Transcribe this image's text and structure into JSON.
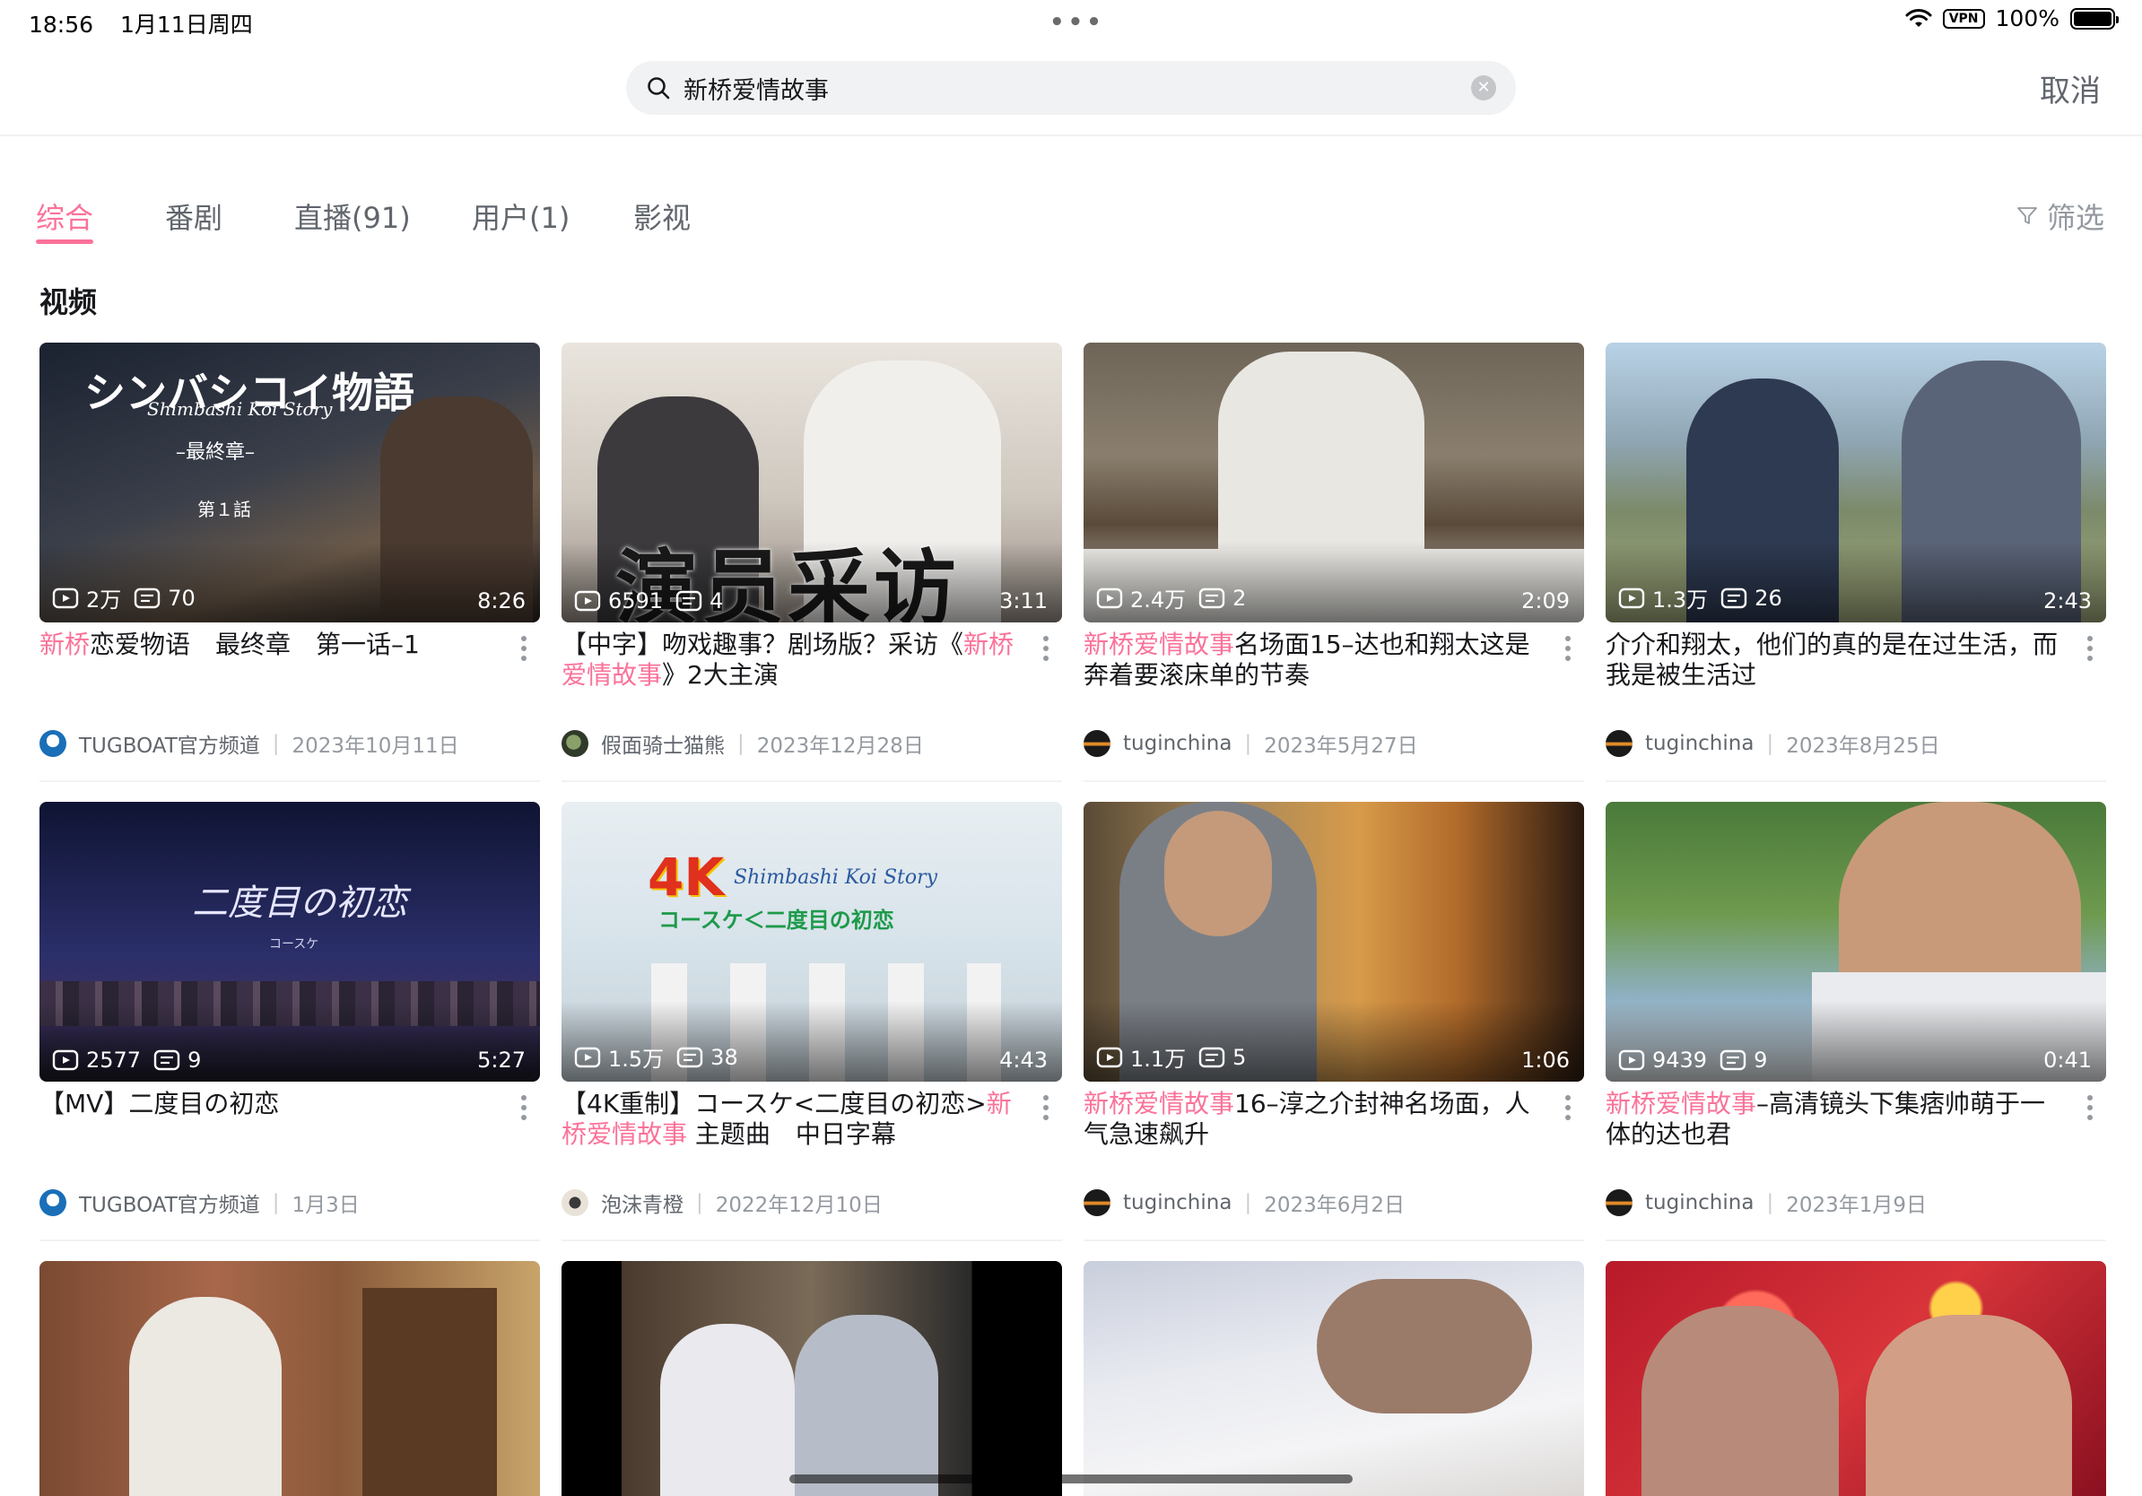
{
  "status_bar": {
    "time": "18:56",
    "date": "1月11日周四",
    "vpn": "VPN",
    "battery": "100%"
  },
  "search": {
    "query": "新桥爱情故事",
    "cancel": "取消"
  },
  "tabs": [
    {
      "label": "综合",
      "active": true
    },
    {
      "label": "番剧",
      "active": false
    },
    {
      "label": "直播(91)",
      "active": false
    },
    {
      "label": "用户(1)",
      "active": false
    },
    {
      "label": "影视",
      "active": false
    }
  ],
  "filter_label": "筛选",
  "section_title": "视频",
  "accent_color": "#fb7299",
  "videos": [
    {
      "title_hl": "新桥",
      "title_rest": "恋爱物语　最终章　第一话–1",
      "title_hl2": "",
      "title_rest2": "",
      "views": "2万",
      "danmaku": "70",
      "duration": "8:26",
      "uploader": "TUGBOAT官方频道",
      "date": "2023年10月11日"
    },
    {
      "title_pre": "【中字】吻戏趣事？剧场版？采访《",
      "title_hl": "新桥爱情故事",
      "title_rest": "》2大主演",
      "views": "6591",
      "danmaku": "4",
      "duration": "3:11",
      "uploader": "假面骑士猫熊",
      "date": "2023年12月28日"
    },
    {
      "title_hl": "新桥爱情故事",
      "title_rest": "名场面15–达也和翔太这是奔着要滚床单的节奏",
      "views": "2.4万",
      "danmaku": "2",
      "duration": "2:09",
      "uploader": "tuginchina",
      "date": "2023年5月27日"
    },
    {
      "title_hl": "",
      "title_rest": "介介和翔太，他们的真的是在过生活，而我是被生活过",
      "views": "1.3万",
      "danmaku": "26",
      "duration": "2:43",
      "uploader": "tuginchina",
      "date": "2023年8月25日"
    },
    {
      "title_hl": "",
      "title_rest": "【MV】二度目の初恋",
      "views": "2577",
      "danmaku": "9",
      "duration": "5:27",
      "uploader": "TUGBOAT官方频道",
      "date": "1月3日"
    },
    {
      "title_pre": "【4K重制】コースケ<二度目の初恋>",
      "title_hl": "新桥爱情故事",
      "title_rest": " 主题曲　中日字幕",
      "views": "1.5万",
      "danmaku": "38",
      "duration": "4:43",
      "uploader": "泡沫青橙",
      "date": "2022年12月10日"
    },
    {
      "title_hl": "新桥爱情故事",
      "title_rest": "16–淳之介封神名场面，人气急速飙升",
      "views": "1.1万",
      "danmaku": "5",
      "duration": "1:06",
      "uploader": "tuginchina",
      "date": "2023年6月2日"
    },
    {
      "title_hl": "新桥爱情故事",
      "title_rest": "–高清镜头下集痞帅萌于一体的达也君",
      "views": "9439",
      "danmaku": "9",
      "duration": "0:41",
      "uploader": "tuginchina",
      "date": "2023年1月9日"
    }
  ],
  "thumb_text": {
    "v1_title": "シンバシコイ物語",
    "v1_sub": "Shimbashi Koi Story",
    "v1_chapter": "–最終章–",
    "v1_episode": "第１話",
    "v2_banner": "演员采访",
    "v5_title": "二度目の初恋",
    "v5_sub": "コースケ",
    "v6_badge": "4K",
    "v6_sub": "Shimbashi Koi Story",
    "v6_title": "コースケ＜二度目の初恋"
  }
}
